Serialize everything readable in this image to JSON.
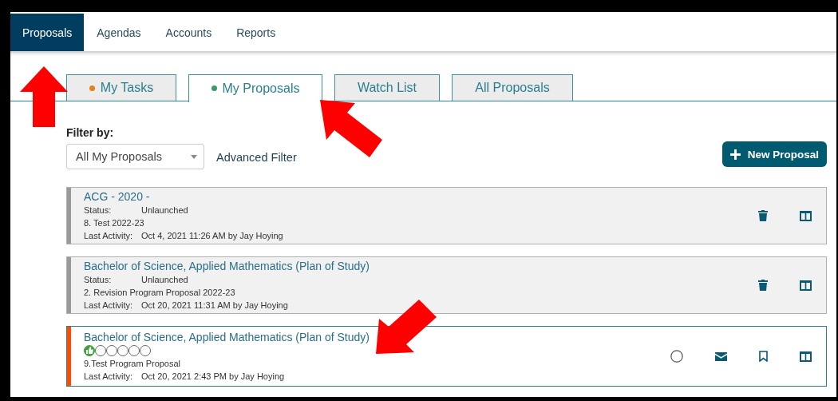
{
  "nav": [
    {
      "label": "Proposals",
      "selected": true
    },
    {
      "label": "Agendas",
      "selected": false
    },
    {
      "label": "Accounts",
      "selected": false
    },
    {
      "label": "Reports",
      "selected": false
    }
  ],
  "tabs": [
    {
      "label": "My Tasks",
      "selected": false,
      "color": "#e8801a"
    },
    {
      "label": "My Proposals",
      "selected": true,
      "color": "#3a9a6a"
    },
    {
      "label": "Watch List",
      "selected": false
    },
    {
      "label": "All Proposals",
      "selected": false
    }
  ],
  "filter": {
    "label": "Filter by:",
    "value": "All My Proposals",
    "advanced_link": "Advanced Filter"
  },
  "new_button": "New Proposal",
  "proposals": [
    {
      "kind": "unlaunched",
      "title": "ACG - 2020 -",
      "status_label": "Status:",
      "status": "Unlaunched",
      "step": "8. Test 2022-23",
      "activity_label": "Last Activity:",
      "activity": "Oct 4, 2021 11:26 AM by Jay Hoying"
    },
    {
      "kind": "unlaunched",
      "title": "Bachelor of Science, Applied Mathematics (Plan of Study)",
      "status_label": "Status:",
      "status": "Unlaunched",
      "step": "2. Revision Program Proposal 2022-23",
      "activity_label": "Last Activity:",
      "activity": "Oct 20, 2021 11:31 AM by Jay Hoying"
    },
    {
      "kind": "launched",
      "title": "Bachelor of Science, Applied Mathematics (Plan of Study)",
      "approvals": [
        {
          "approved": true
        },
        {
          "approved": false
        },
        {
          "approved": false
        },
        {
          "approved": false
        },
        {
          "approved": false
        },
        {
          "approved": false
        }
      ],
      "step": "9.Test Program Proposal",
      "activity_label": "Last Activity:",
      "activity": "Oct 20, 2021 2:43 PM by Jay Hoying"
    }
  ]
}
